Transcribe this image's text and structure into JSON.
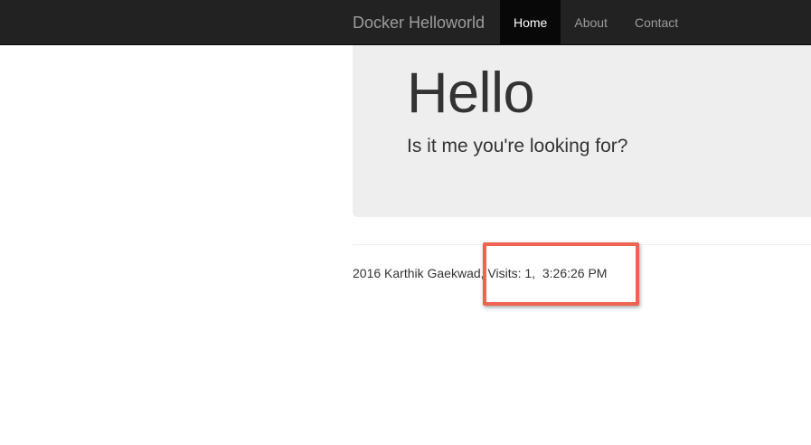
{
  "navbar": {
    "brand": "Docker Helloworld",
    "items": [
      {
        "label": "Home",
        "active": true
      },
      {
        "label": "About",
        "active": false
      },
      {
        "label": "Contact",
        "active": false
      }
    ]
  },
  "jumbotron": {
    "title": "Hello",
    "lead": "Is it me you're looking for?"
  },
  "footer": {
    "copyright": "2016 Karthik Gaekwad,",
    "visits": " Visits: 1,  3:26:26 PM"
  },
  "annotation": {
    "color": "#ee6352"
  }
}
